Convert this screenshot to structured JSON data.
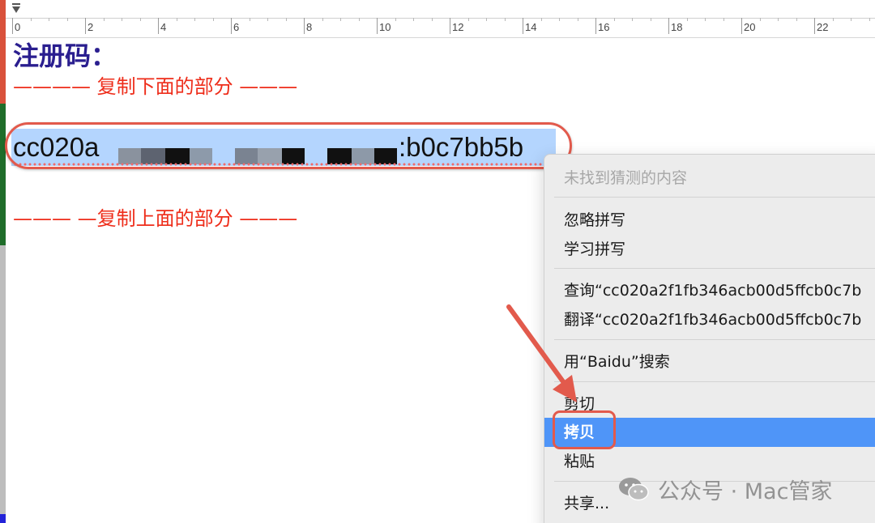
{
  "ruler": {
    "labels": [
      "0",
      "2",
      "4",
      "6",
      "8",
      "10",
      "12",
      "14",
      "16",
      "18",
      "20",
      "22"
    ]
  },
  "document": {
    "heading": "注册码：",
    "copy_below_line": "———— 复制下面的部分 ———",
    "code_visible_start": "cc020a",
    "code_visible_end": ":b0c7bb5b",
    "copy_above_line": "——— —复制上面的部分 ———"
  },
  "context_menu": {
    "no_guesses": "未找到猜测的内容",
    "ignore_spelling": "忽略拼写",
    "learn_spelling": "学习拼写",
    "lookup": "查询“cc020a2f1fb346acb00d5ffcb0c7b",
    "translate": "翻译“cc020a2f1fb346acb00d5ffcb0c7b",
    "search_with": "用“Baidu”搜索",
    "cut": "剪切",
    "copy": "拷贝",
    "paste": "粘贴",
    "share": "共享..."
  },
  "watermark": {
    "text": "公众号 · Mac管家",
    "icon": "wechat-icon"
  },
  "colors": {
    "heading": "#2a1e8f",
    "instruction_red": "#ee2d1a",
    "selection": "#b4d5fe",
    "menu_highlight": "#4f95f8",
    "annotation_red": "#e25a4c"
  }
}
